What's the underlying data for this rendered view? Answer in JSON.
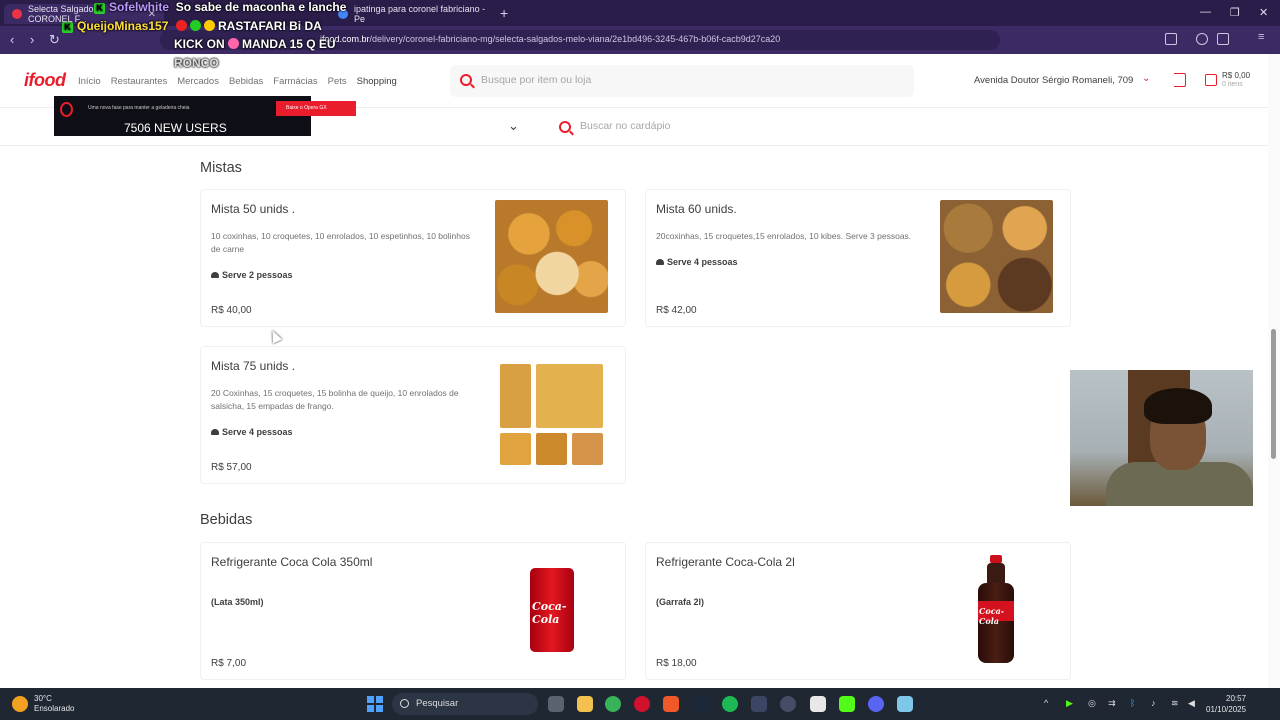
{
  "browser": {
    "tabs": [
      {
        "title": "Selecta Salgados | CORONEL F...",
        "active": true
      },
      {
        "title": "Sofelwhite",
        "active": false
      },
      {
        "title": "ipatinga para coronel fabriciano - Pe",
        "active": false
      }
    ],
    "url_prefix": "ifood.com.br",
    "url_path": "/delivery/coronel-fabriciano-mg/selecta-salgados-melo-viana/2e1bd496-3245-467b-b06f-cacb9d27ca20"
  },
  "overlay": {
    "user1": "Sofelwhite",
    "message": "So sabe de maconha e lanche",
    "user2": "QueijoMinas157",
    "line2": "RASTAFARI Bi DA",
    "line3": "KICK ON",
    "line3b": "MANDA 15 Q EU",
    "line4": "RONCO"
  },
  "site": {
    "logo": "ifood",
    "nav": [
      "Início",
      "Restaurantes",
      "Mercados",
      "Bebidas",
      "Farmácias",
      "Pets",
      "Shopping"
    ],
    "search_placeholder": "Busque por item ou loja",
    "address": "Avenida Doutor Sérgio Romaneli, 709",
    "cart_total": "R$ 0,00",
    "cart_items": "0 itens"
  },
  "ad": {
    "text": "Uma nova fase para manter a geladeira cheia",
    "button": "Baixe o Opera GX",
    "users": "7506 NEW USERS"
  },
  "menu_search_placeholder": "Buscar no cardápio",
  "sections": [
    {
      "title": "Mistas",
      "items": [
        {
          "name": "Mista 50 unids .",
          "desc": "10 coxinhas, 10 croquetes, 10 enrolados, 10 espetinhos, 10 bolinhos de carne",
          "serves": "Serve 2 pessoas",
          "price": "R$ 40,00"
        },
        {
          "name": "Mista 60 unids.",
          "desc": "20coxinhas, 15 croquetes,15 enrolados, 10 kibes. Serve 3 pessoas.",
          "serves": "Serve 4 pessoas",
          "price": "R$ 42,00"
        },
        {
          "name": "Mista 75 unids .",
          "desc": "20 Coxinhas, 15 croquetes, 15 bolinha de queijo, 10 enrolados de salsicha, 15 empadas de frango.",
          "serves": "Serve 4 pessoas",
          "price": "R$ 57,00"
        }
      ]
    },
    {
      "title": "Bebidas",
      "items": [
        {
          "name": "Refrigerante Coca Cola 350ml",
          "desc": "(Lata 350ml)",
          "price": "R$ 7,00",
          "brand": "Coca-Cola"
        },
        {
          "name": "Refrigerante Coca-Cola 2l",
          "desc": "(Garrafa 2l)",
          "price": "R$ 18,00",
          "brand": "Coca-Cola"
        }
      ]
    }
  ],
  "taskbar": {
    "temp": "30°C",
    "weather": "Ensolarado",
    "search": "Pesquisar",
    "time": "20:57",
    "date": "01/10/2025"
  }
}
